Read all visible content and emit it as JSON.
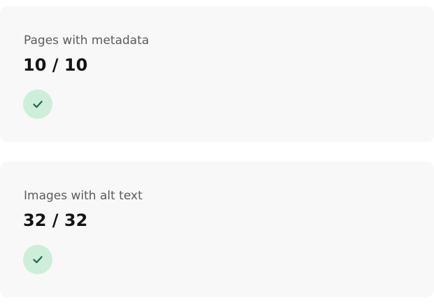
{
  "cards": [
    {
      "label": "Pages with metadata",
      "value": "10 / 10",
      "status_icon": "check-icon"
    },
    {
      "label": "Images with alt text",
      "value": "32 / 32",
      "status_icon": "check-icon"
    }
  ],
  "colors": {
    "card_background": "#f8f8f8",
    "badge_background": "#cdeed9",
    "check_color": "#1f6b45",
    "label_color": "#5c5c5c",
    "value_color": "#141414"
  }
}
